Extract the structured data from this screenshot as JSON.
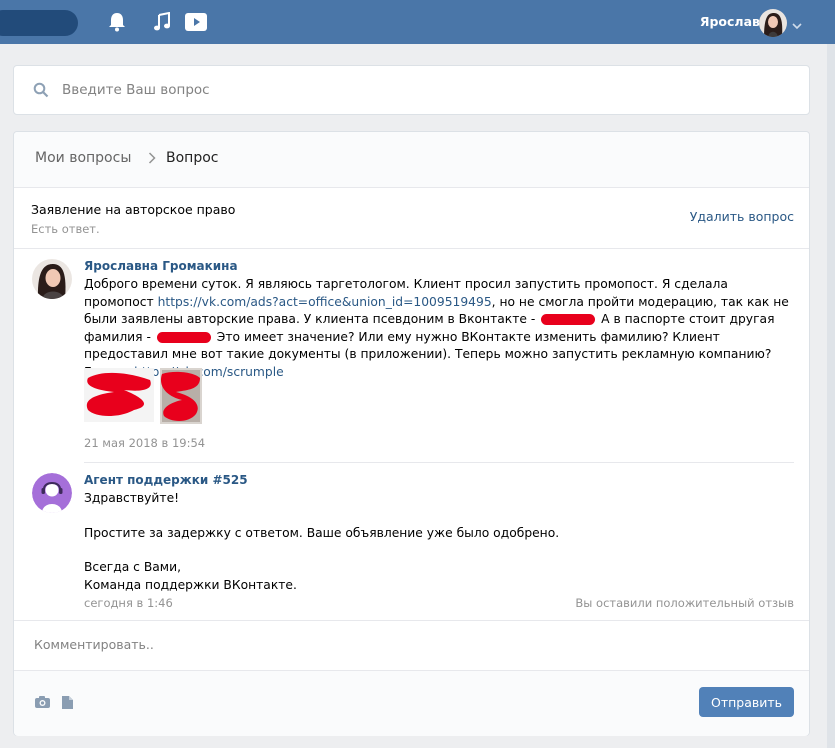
{
  "topbar": {
    "user_name": "Ярославна"
  },
  "search": {
    "placeholder": "Введите Ваш вопрос",
    "value": ""
  },
  "breadcrumb": {
    "root": "Мои вопросы",
    "current": "Вопрос"
  },
  "ticket": {
    "subject": "Заявление на авторское право",
    "status": "Есть ответ.",
    "delete_label": "Удалить вопрос"
  },
  "messages": [
    {
      "author": "Ярославна Громакина",
      "text_1": "Доброго времени суток. Я являюсь таргетологом. Клиент просил запустить промопост. Я сделала промопост",
      "link_1": "https://vk.com/ads?act=office&union_id=1009519495",
      "text_2": ", но не смогла пройти модерацию, так как не были заявлены авторские права. У клиента псевдоним в Вконтакте -",
      "text_3": "А в паспорте стоит другая фамилия -",
      "text_4": "Это имеет значение? Или ему нужно ВКонтакте изменить фамилию? Клиент предоставил мне вот такие документы (в приложении). Теперь можно запустить рекламную компанию? Группа",
      "link_2": "https://vk.com/scrumple",
      "date": "21 мая 2018 в 19:54"
    },
    {
      "author": "Агент поддержки #525",
      "greeting": "Здравствуйте!",
      "body": "Простите за задержку с ответом. Ваше объявление уже было одобрено.",
      "sign_1": "Всегда с Вами,",
      "sign_2": "Команда поддержки ВКонтакте.",
      "date": "сегодня в 1:46",
      "feedback": "Вы оставили положительный отзыв"
    }
  ],
  "comment": {
    "placeholder": "Комментировать..",
    "value": ""
  },
  "footer": {
    "send_label": "Отправить"
  },
  "icons": {
    "top": [
      "bell-icon",
      "music-icon",
      "video-icon",
      "chevron-down-icon"
    ],
    "search": "search-icon",
    "breadcrumb": "chevron-right-icon",
    "footer": [
      "camera-icon",
      "document-icon"
    ]
  },
  "colors": {
    "header": "#4a76a8",
    "link": "#2a5885",
    "button": "#5181b8",
    "redaction": "#e8001c",
    "support_avatar": "#a56fd9"
  }
}
